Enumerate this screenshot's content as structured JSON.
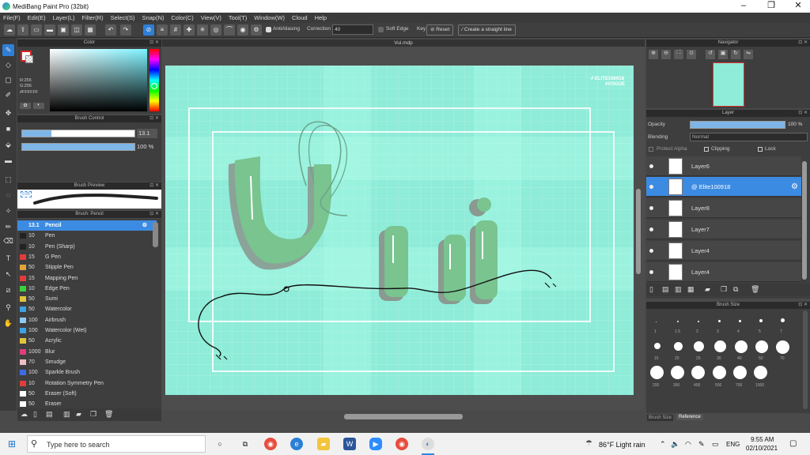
{
  "window": {
    "title": "MediBang Paint Pro (32bit)",
    "minimize": "–",
    "maximize": "❐",
    "close": "✕"
  },
  "menu": [
    "File(F)",
    "Edit(E)",
    "Layer(L)",
    "Filter(R)",
    "Select(S)",
    "Snap(N)",
    "Color(C)",
    "View(V)",
    "Tool(T)",
    "Window(W)",
    "Cloud",
    "Help"
  ],
  "toolbar": {
    "antialiasing": "AntiAliasing",
    "correction_label": "Correction",
    "correction_value": "40",
    "soft_edge": "Soft Edge",
    "key": "Key",
    "reset": "Reset",
    "straight_line": "Create a straight line"
  },
  "color_panel": {
    "title": "Color",
    "r": "R:255",
    "g": "G:255",
    "b": "B:255",
    "hex": "#FFFFFF"
  },
  "brush_control": {
    "title": "Brush Control",
    "size": "13.1",
    "opacity": "100 %",
    "size_fraction": 0.26,
    "opacity_fraction": 1.0
  },
  "brush_preview": {
    "title": "Brush Preview",
    "value": "0.95"
  },
  "brush_list": {
    "title": "Brush: Pencil",
    "items": [
      {
        "size": "13.1",
        "name": "Pencil",
        "color": "#3c8be2"
      },
      {
        "size": "10",
        "name": "Pen",
        "color": "#222222"
      },
      {
        "size": "10",
        "name": "Pen (Sharp)",
        "color": "#222222"
      },
      {
        "size": "15",
        "name": "G Pen",
        "color": "#e23c3c"
      },
      {
        "size": "50",
        "name": "Stipple Pen",
        "color": "#e2a23c"
      },
      {
        "size": "15",
        "name": "Mapping Pen",
        "color": "#e23c3c"
      },
      {
        "size": "10",
        "name": "Edge Pen",
        "color": "#3ccf3c"
      },
      {
        "size": "50",
        "name": "Sumi",
        "color": "#e2c43c"
      },
      {
        "size": "50",
        "name": "Watercolor",
        "color": "#3ca2e2"
      },
      {
        "size": "100",
        "name": "Airbrush",
        "color": "#8fc8f0"
      },
      {
        "size": "100",
        "name": "Watercolor (Wet)",
        "color": "#3ca2e2"
      },
      {
        "size": "50",
        "name": "Acrylic",
        "color": "#e2c43c"
      },
      {
        "size": "1000",
        "name": "Blur",
        "color": "#e23c7c"
      },
      {
        "size": "70",
        "name": "Smudge",
        "color": "#f0c0c0"
      },
      {
        "size": "100",
        "name": "Sparkle Brush",
        "color": "#3c6ce2"
      },
      {
        "size": "10",
        "name": "Rotation Symmetry Pen",
        "color": "#e23c3c"
      },
      {
        "size": "50",
        "name": "Eraser (Soft)",
        "color": "#ffffff"
      },
      {
        "size": "50",
        "name": "Eraser",
        "color": "#ffffff"
      }
    ]
  },
  "canvas": {
    "tab": "Vui.mdp",
    "watermark_1": "# ELITE100918",
    "watermark_2": "#VOGUE"
  },
  "navigator": {
    "title": "Navigator"
  },
  "layer_panel": {
    "title": "Layer",
    "opacity_label": "Opacity",
    "opacity_value": "100 %",
    "blending_label": "Blending",
    "blending_value": "Normal",
    "protect_alpha": "Protect Alpha",
    "clipping": "Clipping",
    "lock": "Lock",
    "layers": [
      "Layer6",
      "@ Elite100918",
      "Layer8",
      "Layer7",
      "Layer4",
      "Layer4"
    ]
  },
  "brush_size": {
    "title": "Brush Size",
    "sizes": [
      "1",
      "1.5",
      "2",
      "3",
      "4",
      "5",
      "7",
      "15",
      "20",
      "25",
      "30",
      "40",
      "50",
      "70",
      "200",
      "300",
      "400",
      "500",
      "700",
      "1000"
    ],
    "tab1": "Brush Size",
    "tab2": "Reference"
  },
  "taskbar": {
    "search": "Type here to search",
    "weather": "86°F  Light rain",
    "lang": "ENG",
    "time": "9:55 AM",
    "date": "02/10/2021"
  },
  "colors": {
    "accent": "#3c8be2",
    "canvas_bg": "#8eecd8",
    "panel": "#3e3e3e"
  }
}
